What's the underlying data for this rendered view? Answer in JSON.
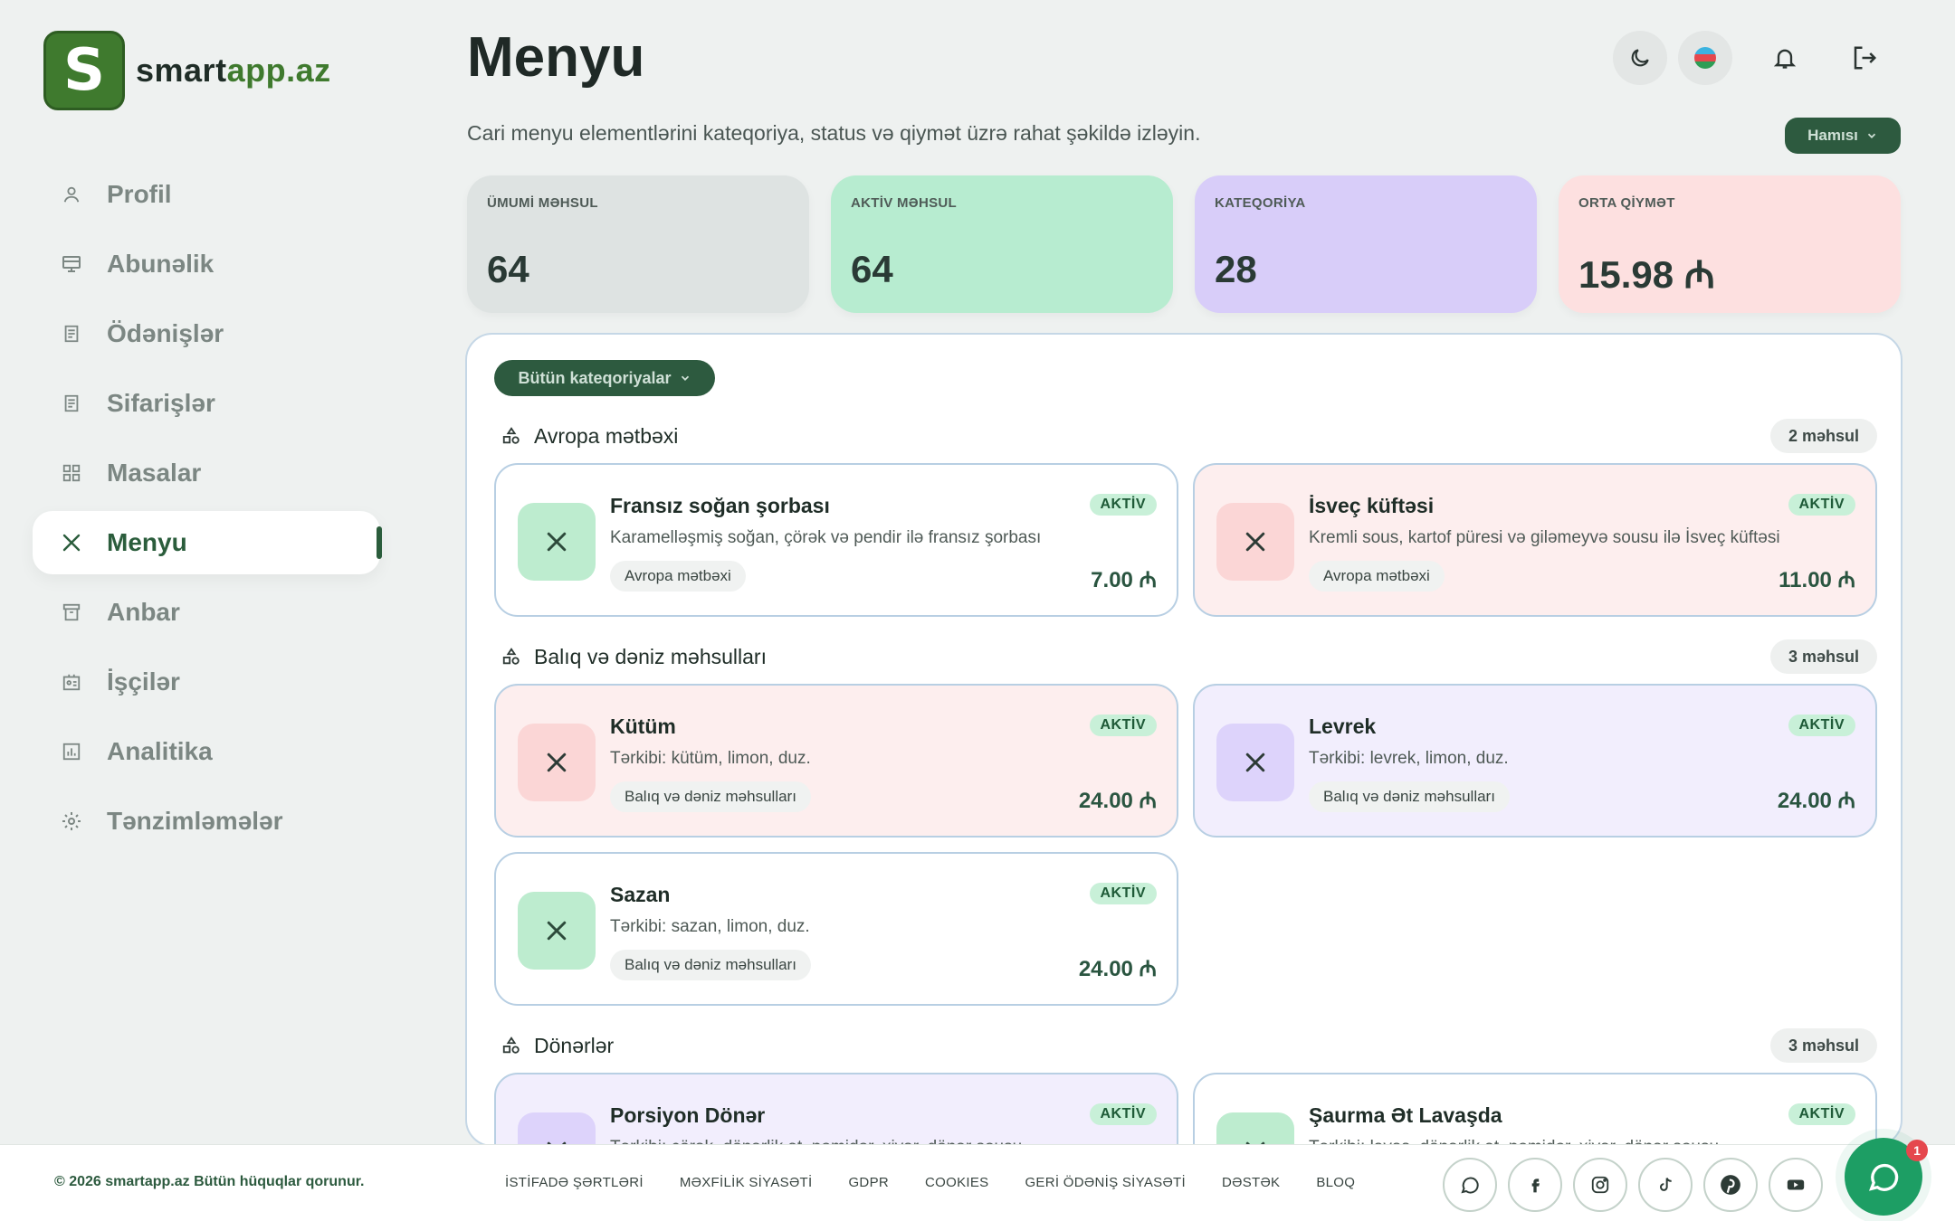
{
  "brand": {
    "logo_letter": "S",
    "name_a": "smart",
    "name_b": "app.az"
  },
  "sidebar": {
    "items": [
      {
        "label": "Profil",
        "icon": "user-icon"
      },
      {
        "label": "Abunəlik",
        "icon": "subscription-icon"
      },
      {
        "label": "Ödənişlər",
        "icon": "receipt-icon"
      },
      {
        "label": "Sifarişlər",
        "icon": "receipt-icon"
      },
      {
        "label": "Masalar",
        "icon": "grid-icon"
      },
      {
        "label": "Menyu",
        "icon": "utensils-icon",
        "active": true
      },
      {
        "label": "Anbar",
        "icon": "archive-icon"
      },
      {
        "label": "İşçilər",
        "icon": "id-card-icon"
      },
      {
        "label": "Analitika",
        "icon": "chart-icon"
      },
      {
        "label": "Tənzimləmələr",
        "icon": "gear-icon"
      }
    ]
  },
  "header": {
    "title": "Menyu",
    "subtitle": "Cari menyu elementlərini kateqoriya, status və qiymət üzrə rahat şəkildə izləyin.",
    "filter_label": "Hamısı"
  },
  "stats": [
    {
      "label": "ÜMUMİ MƏHSUL",
      "value": "64",
      "color": "#dee3e2"
    },
    {
      "label": "AKTİV MƏHSUL",
      "value": "64",
      "color": "#b7ecd0"
    },
    {
      "label": "KATEQORİYA",
      "value": "28",
      "color": "#d8cdf9"
    },
    {
      "label": "ORTA QİYMƏT",
      "value": "15.98 ₼",
      "color": "#fde0e0"
    }
  ],
  "panel": {
    "category_dropdown": "Bütün kateqoriyalar",
    "sections": [
      {
        "name": "Avropa mətbəxi",
        "count": "2 məhsul"
      },
      {
        "name": "Balıq və dəniz məhsulları",
        "count": "3 məhsul"
      },
      {
        "name": "Dönərlər",
        "count": "3 məhsul"
      }
    ],
    "items": [
      {
        "name": "Fransız soğan şorbası",
        "desc": "Karamelləşmiş soğan, çörək və pendir ilə fransız şorbası",
        "tag": "Avropa mətbəxi",
        "status": "AKTİV",
        "price": "7.00 ₼"
      },
      {
        "name": "İsveç küftəsi",
        "desc": "Kremli sous, kartof püresi və giləmeyvə sousu ilə İsveç küftəsi",
        "tag": "Avropa mətbəxi",
        "status": "AKTİV",
        "price": "11.00 ₼"
      },
      {
        "name": "Kütüm",
        "desc": "Tərkibi: kütüm, limon, duz.",
        "tag": "Balıq və dəniz məhsulları",
        "status": "AKTİV",
        "price": "24.00 ₼"
      },
      {
        "name": "Levrek",
        "desc": "Tərkibi: levrek, limon, duz.",
        "tag": "Balıq və dəniz məhsulları",
        "status": "AKTİV",
        "price": "24.00 ₼"
      },
      {
        "name": "Sazan",
        "desc": "Tərkibi: sazan, limon, duz.",
        "tag": "Balıq və dəniz məhsulları",
        "status": "AKTİV",
        "price": "24.00 ₼"
      },
      {
        "name": "Porsiyon Dönər",
        "desc": "Tərkibi: çörək, dönərlik ət, pomidor, xiyar, dönər sousu",
        "tag": "",
        "status": "AKTİV",
        "price": ""
      },
      {
        "name": "Şaurma Ət Lavaşda",
        "desc": "Tərkibi: lavaş, dönərlik ət, pomidor, xiyar, dönər sousu",
        "tag": "",
        "status": "AKTİV",
        "price": ""
      }
    ]
  },
  "footer": {
    "copyright": "© 2026 smartapp.az Bütün hüquqlar qorunur.",
    "links": [
      "İSTİFADƏ ŞƏRTLƏRİ",
      "MƏXFİLİK SİYASƏTİ",
      "GDPR",
      "COOKIES",
      "GERİ ÖDƏNİŞ SİYASƏTİ",
      "DƏSTƏK",
      "BLOQ"
    ],
    "socials": [
      "whatsapp-icon",
      "facebook-icon",
      "instagram-icon",
      "tiktok-icon",
      "pinterest-icon",
      "youtube-icon"
    ],
    "chat_badge": "1"
  }
}
